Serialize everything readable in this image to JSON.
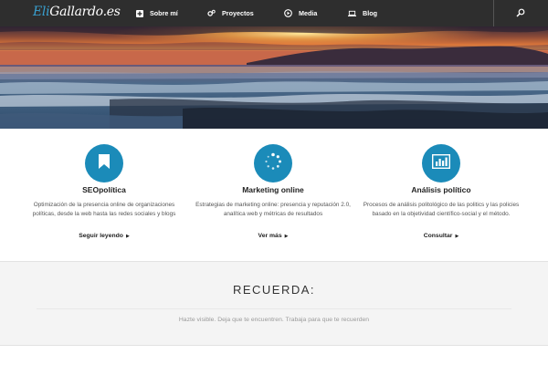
{
  "nav": {
    "logo_prefix": "Eli",
    "logo_main": "Gallardo",
    "logo_suffix": ".es",
    "items": [
      {
        "label": "Sobre mí",
        "icon": "plus-square-icon"
      },
      {
        "label": "Proyectos",
        "icon": "gears-icon"
      },
      {
        "label": "Media",
        "icon": "play-circle-icon"
      },
      {
        "label": "Blog",
        "icon": "laptop-icon"
      }
    ],
    "search_icon": "search-icon"
  },
  "hero": {
    "description_icon": "sunset-sea-photo"
  },
  "features": [
    {
      "title": "SEOpolítica",
      "text": "Optimización de la presencia online de organizaciones políticas, desde la web hasta las redes sociales y blogs",
      "link": "Seguir leyendo",
      "icon": "bookmark-icon"
    },
    {
      "title": "Marketing online",
      "text": "Estrategias de marketing online: presencia y reputación 2.0, analítica web y métricas de resultados",
      "link": "Ver más",
      "icon": "spinner-icon"
    },
    {
      "title": "Análisis político",
      "text": "Procesos de análisis politológico de las politics y las policies basado en la objetividad científico-social y el método.",
      "link": "Consultar",
      "icon": "bar-chart-icon"
    }
  ],
  "recuerda": {
    "title": "RECUERDA:",
    "text": "Hazte visible. Deja que te encuentren. Trabaja para que te recuerden"
  },
  "colors": {
    "nav_bg": "#2e2e2e",
    "accent": "#1b8bb9",
    "logo_accent": "#39a0d0"
  }
}
